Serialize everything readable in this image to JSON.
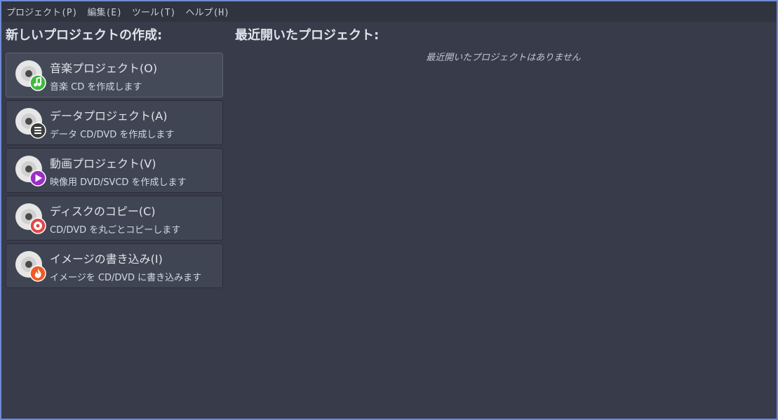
{
  "menubar": {
    "items": [
      "プロジェクト(P)",
      "編集(E)",
      "ツール(T)",
      "ヘルプ(H)"
    ]
  },
  "new_project": {
    "title": "新しいプロジェクトの作成:",
    "buttons": [
      {
        "title": "音楽プロジェクト(O)",
        "description": "音楽 CD を作成します",
        "badge_icon": "music-note-icon",
        "badge_color": "#3fb93f"
      },
      {
        "title": "データプロジェクト(A)",
        "description": "データ CD/DVD を作成します",
        "badge_icon": "list-icon",
        "badge_color": "#3c3c3c"
      },
      {
        "title": "動画プロジェクト(V)",
        "description": "映像用 DVD/SVCD を作成します",
        "badge_icon": "play-icon",
        "badge_color": "#9b2fc7"
      },
      {
        "title": "ディスクのコピー(C)",
        "description": "CD/DVD を丸ごとコピーします",
        "badge_icon": "record-icon",
        "badge_color": "#e04848"
      },
      {
        "title": "イメージの書き込み(I)",
        "description": "イメージを CD/DVD に書き込みます",
        "badge_icon": "fire-icon",
        "badge_color": "#f05a24"
      }
    ]
  },
  "recent": {
    "title": "最近開いたプロジェクト:",
    "empty_message": "最近開いたプロジェクトはありません"
  },
  "colors": {
    "window_bg": "#383c4a",
    "menubar_bg": "#2f343f",
    "button_bg": "#404553",
    "outer_border": "#6f8bd6"
  }
}
